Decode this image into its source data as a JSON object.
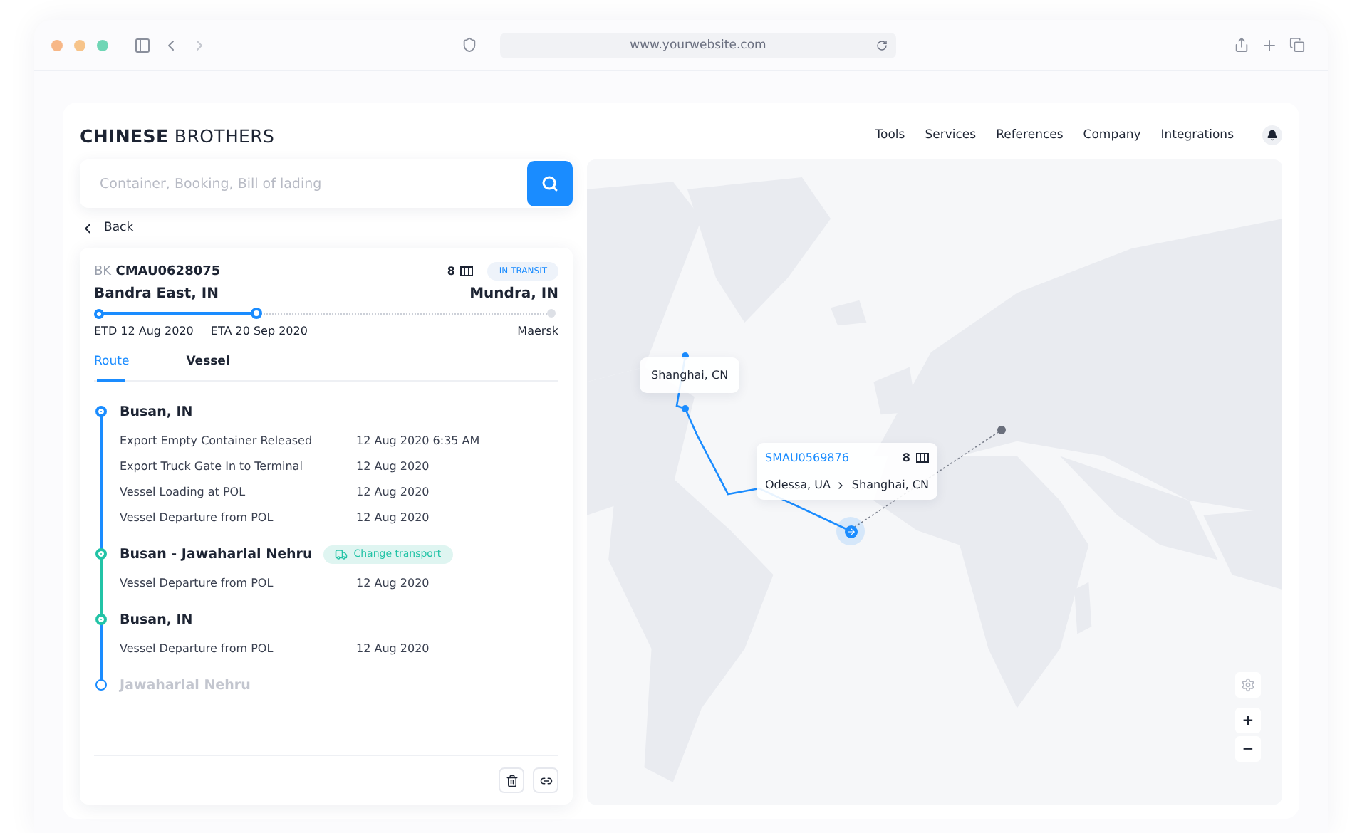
{
  "browser": {
    "url": "www.yourwebsite.com"
  },
  "brand": {
    "bold": "CHINESE",
    "rest": "BROTHERS"
  },
  "nav": [
    "Tools",
    "Services",
    "References",
    "Company",
    "Integrations"
  ],
  "search": {
    "placeholder": "Container, Booking, Bill of lading"
  },
  "back": "Back",
  "shipment": {
    "prefix": "BK",
    "number": "CMAU0628075",
    "count": "8",
    "status": "IN TRANSIT",
    "origin": "Bandra East, IN",
    "destination": "Mundra, IN",
    "level": 0.35,
    "etd": "ETD 12 Aug 2020",
    "eta": "ETA 20 Sep 2020",
    "carrier": "Maersk"
  },
  "tabs": [
    {
      "label": "Route",
      "selected": true
    },
    {
      "label": "Vessel",
      "selected": false
    }
  ],
  "stops": [
    {
      "name": "Busan, IN",
      "kind": "passed",
      "events": [
        {
          "label": "Export Empty Container Released",
          "date": "12 Aug 2020 6:35 AM"
        },
        {
          "label": "Export Truck Gate In to Terminal",
          "date": "12 Aug 2020"
        },
        {
          "label": "Vessel Loading at POL",
          "date": "12 Aug 2020"
        },
        {
          "label": "Vessel Departure from POL",
          "date": "12 Aug 2020"
        }
      ]
    },
    {
      "name": "Busan - Jawaharlal Nehru",
      "kind": "transfer",
      "badge": "Change transport",
      "events": [
        {
          "label": "Vessel Departure from POL",
          "date": "12 Aug 2020"
        }
      ]
    },
    {
      "name": "Busan, IN",
      "kind": "transfer",
      "events": [
        {
          "label": "Vessel Departure from POL",
          "date": "12 Aug 2020"
        }
      ]
    },
    {
      "name": "Jawaharlal Nehru",
      "kind": "upcoming"
    }
  ],
  "map": {
    "label": "Shanghai, CN",
    "card": {
      "number": "SMAU0569876",
      "count": "8",
      "from": "Odessa, UA",
      "to": "Shanghai, CN"
    },
    "zoom_in": "+",
    "zoom_out": "−"
  }
}
